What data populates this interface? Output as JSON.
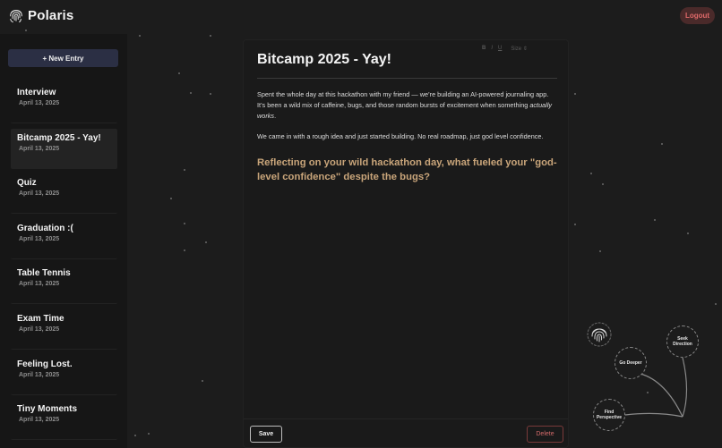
{
  "header": {
    "app_name": "Polaris",
    "logo_icon": "polaris-fingerprint-icon",
    "logout_label": "Logout"
  },
  "sidebar": {
    "new_entry_label": "+ New Entry",
    "entries": [
      {
        "title": "Interview",
        "date": "April 13, 2025"
      },
      {
        "title": "Bitcamp 2025 - Yay!",
        "date": "April 13, 2025",
        "active": true
      },
      {
        "title": "Quiz",
        "date": "April 13, 2025"
      },
      {
        "title": "Graduation :(",
        "date": "April 13, 2025"
      },
      {
        "title": "Table Tennis",
        "date": "April 13, 2025"
      },
      {
        "title": "Exam Time",
        "date": "April 13, 2025"
      },
      {
        "title": "Feeling Lost.",
        "date": "April 13, 2025"
      },
      {
        "title": "Tiny Moments",
        "date": "April 13, 2025"
      }
    ]
  },
  "editor": {
    "toolbar": {
      "bold": "B",
      "italic": "I",
      "underline": "U",
      "size": "Size ⇕"
    },
    "title": "Bitcamp 2025 - Yay!",
    "para1_before": "Spent the whole day at this hackathon with my friend — we’re building an AI-powered journaling app. It’s been a wild mix of caffeine, bugs, and those random bursts of excitement when something ",
    "para1_italic": "actually works",
    "para1_after": ".",
    "para2": "We came in with a rough idea and just started building. No real roadmap, just god level confidence.",
    "prompt": "Reflecting on your wild hackathon day, what fueled your \"god-level confidence\" despite the bugs?",
    "save_label": "Save",
    "delete_label": "Delete"
  },
  "wheel": {
    "seek_direction": "Seek\nDirection",
    "go_deeper": "Go Deeper",
    "find_perspective": "Find\nPerspective",
    "center_icon": "fingerprint-icon"
  },
  "colors": {
    "background": "#1c1c1c",
    "sidebar": "#161616",
    "accent_prompt": "#c9a57a",
    "new_entry_bg": "#2b2f44",
    "logout_bg": "#4a2a2a",
    "logout_text": "#e06a6a"
  }
}
